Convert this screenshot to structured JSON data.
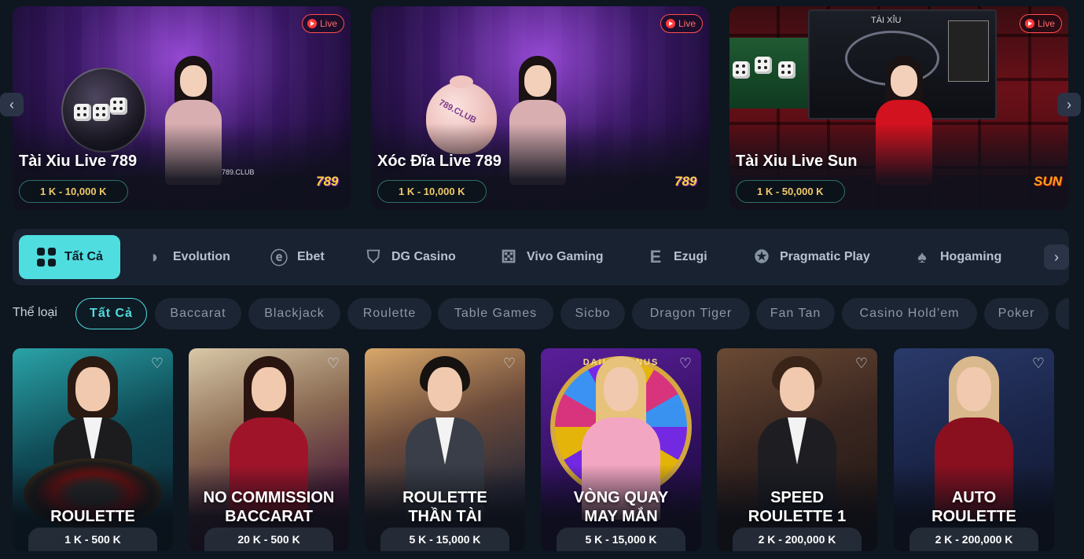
{
  "carousel": {
    "cards": [
      {
        "title": "Tài Xiu Live 789",
        "range": "1 K - 10,000 K",
        "badge": "Live",
        "scene_text": "789.CLUB",
        "logo": "789"
      },
      {
        "title": "Xóc Đĩa Live 789",
        "range": "1 K - 10,000 K",
        "badge": "Live",
        "scene_text": "789.CLUB",
        "logo": "789"
      },
      {
        "title": "Tài Xiu Live Sun",
        "range": "1 K - 50,000 K",
        "badge": "Live",
        "scene_text": "TÀI XỈU",
        "logo": "SUN"
      }
    ],
    "prev_icon": "chevron-left-icon",
    "next_icon": "chevron-right-icon"
  },
  "providers": {
    "items": [
      {
        "label": "Tất Cả",
        "icon": "grid-icon",
        "active": true
      },
      {
        "label": "Evolution",
        "icon": "evolution-icon"
      },
      {
        "label": "Ebet",
        "icon": "ebet-icon"
      },
      {
        "label": "DG Casino",
        "icon": "dg-casino-icon"
      },
      {
        "label": "Vivo Gaming",
        "icon": "vivo-gaming-icon"
      },
      {
        "label": "Ezugi",
        "icon": "ezugi-icon"
      },
      {
        "label": "Pragmatic Play",
        "icon": "pragmatic-play-icon"
      },
      {
        "label": "Hogaming",
        "icon": "hogaming-icon"
      }
    ],
    "next_icon": "chevron-right-icon"
  },
  "categories": {
    "label": "Thể loại",
    "items": [
      "Tất Cả",
      "Baccarat",
      "Blackjack",
      "Roulette",
      "Table Games",
      "Sicbo",
      "Dragon Tiger",
      "Fan Tan",
      "Casino Hold’em",
      "Poker"
    ],
    "active": "Tất Cả"
  },
  "games": [
    {
      "title_line1": "",
      "title_line2": "ROULETTE",
      "range": "1 K - 500 K"
    },
    {
      "title_line1": "NO COMMISSION",
      "title_line2": "BACCARAT",
      "range": "20 K - 500 K"
    },
    {
      "title_line1": "ROULETTE",
      "title_line2": "THẦN TÀI",
      "range": "5 K - 15,000 K"
    },
    {
      "title_line1": "VÒNG QUAY",
      "title_line2": "MAY MẮN",
      "range": "5 K - 15,000 K",
      "scene_text": "DAILY BONUS"
    },
    {
      "title_line1": "SPEED",
      "title_line2": "ROULETTE 1",
      "range": "2 K - 200,000 K"
    },
    {
      "title_line1": "AUTO",
      "title_line2": "ROULETTE",
      "range": "2 K - 200,000 K"
    }
  ],
  "colors": {
    "accent": "#4fdde0",
    "live_badge": "#ff4d4d",
    "range_text": "#f0c96a",
    "page_bg": "#0e1620",
    "panel_bg": "#182230"
  }
}
